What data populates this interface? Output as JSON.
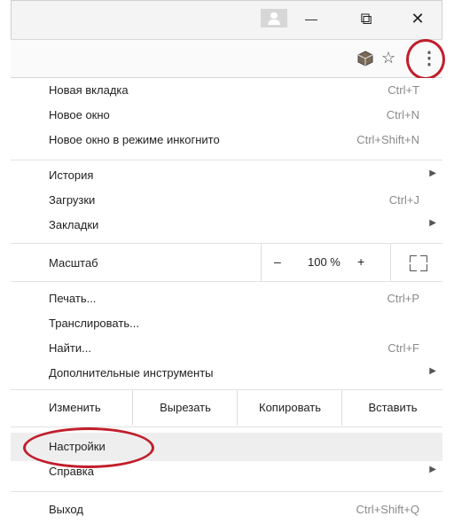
{
  "titlebar": {
    "minimize": "—",
    "restore": "⧉",
    "close": "✕"
  },
  "toolbar": {
    "extension_icon": "cube-icon",
    "star": "☆",
    "menu_dots": "⋮"
  },
  "menu": {
    "new_tab": {
      "label": "Новая вкладка",
      "shortcut": "Ctrl+T"
    },
    "new_window": {
      "label": "Новое окно",
      "shortcut": "Ctrl+N"
    },
    "incognito": {
      "label": "Новое окно в режиме инкогнито",
      "shortcut": "Ctrl+Shift+N"
    },
    "history": {
      "label": "История"
    },
    "downloads": {
      "label": "Загрузки",
      "shortcut": "Ctrl+J"
    },
    "bookmarks": {
      "label": "Закладки"
    },
    "zoom": {
      "label": "Масштаб",
      "minus": "–",
      "value": "100 %",
      "plus": "+"
    },
    "print": {
      "label": "Печать...",
      "shortcut": "Ctrl+P"
    },
    "cast": {
      "label": "Транслировать..."
    },
    "find": {
      "label": "Найти...",
      "shortcut": "Ctrl+F"
    },
    "more_tools": {
      "label": "Дополнительные инструменты"
    },
    "edit": {
      "label": "Изменить",
      "cut": "Вырезать",
      "copy": "Копировать",
      "paste": "Вставить"
    },
    "settings": {
      "label": "Настройки"
    },
    "help": {
      "label": "Справка"
    },
    "exit": {
      "label": "Выход",
      "shortcut": "Ctrl+Shift+Q"
    },
    "submenu_arrow": "▶"
  },
  "colors": {
    "highlight_circle": "#c01e2c",
    "hover_row": "#eeeeee"
  }
}
